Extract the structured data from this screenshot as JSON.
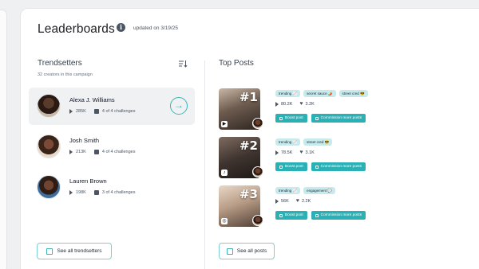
{
  "header": {
    "title": "Leaderboards",
    "updated": "updated on 3/19/25"
  },
  "trendsetters": {
    "title": "Trendsetters",
    "subtitle": "32 creators in this campaign",
    "items": [
      {
        "name": "Alexa J. Williams",
        "views": "285K",
        "challenges": "4 of 4 challenges"
      },
      {
        "name": "Josh Smith",
        "views": "213K",
        "challenges": "4 of 4 challenges"
      },
      {
        "name": "Lauren Brown",
        "views": "198K",
        "challenges": "3 of 4 challenges"
      }
    ],
    "see_all": "See all trendsetters"
  },
  "top_posts": {
    "title": "Top Posts",
    "items": [
      {
        "rank": "#1",
        "tags": [
          "trending 📈",
          "secret sauce 🌶️",
          "street cred 😎"
        ],
        "views": "80.2K",
        "likes": "3.2K",
        "platform": "youtube-icon"
      },
      {
        "rank": "#2",
        "tags": [
          "trending 📈",
          "street cred 😎"
        ],
        "views": "78.5K",
        "likes": "3.1K",
        "platform": "tiktok-icon"
      },
      {
        "rank": "#3",
        "tags": [
          "trending 📈",
          "engagement 💬"
        ],
        "views": "56K",
        "likes": "2.2K",
        "platform": "instagram-icon"
      }
    ],
    "boost_label": "Boost post",
    "commission_label": "Commission more posts",
    "see_all": "See all posts"
  },
  "colors": {
    "accent": "#2bb1b5",
    "tag_bg": "#c7ebec"
  }
}
